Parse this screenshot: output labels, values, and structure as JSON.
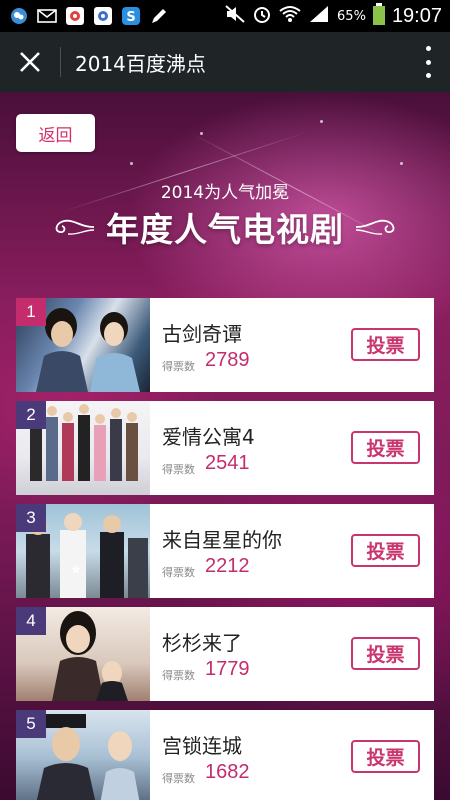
{
  "status_bar": {
    "battery": "65%",
    "time": "19:07"
  },
  "appbar": {
    "title": "2014百度沸点"
  },
  "page": {
    "back_label": "返回",
    "subtitle": "2014为人气加冕",
    "headline": "年度人气电视剧",
    "votes_label": "得票数",
    "vote_button_label": "投票"
  },
  "items": [
    {
      "rank": "1",
      "title": "古剑奇谭",
      "votes": "2789",
      "rank_color": "#c42c6d"
    },
    {
      "rank": "2",
      "title": "爱情公寓4",
      "votes": "2541",
      "rank_color": "#4a3a7a"
    },
    {
      "rank": "3",
      "title": "来自星星的你",
      "votes": "2212",
      "rank_color": "#4a3a7a"
    },
    {
      "rank": "4",
      "title": "杉杉来了",
      "votes": "1779",
      "rank_color": "#4a3a7a"
    },
    {
      "rank": "5",
      "title": "宫锁连城",
      "votes": "1682",
      "rank_color": "#4a3a7a"
    }
  ],
  "colors": {
    "accent": "#c42c6d",
    "appbar_bg": "#1f2426"
  },
  "icons": [
    "wechat-notification-icon",
    "email-icon",
    "app-icon",
    "app-icon",
    "skype-icon",
    "pencil-icon",
    "mute-icon",
    "alarm-icon",
    "wifi-icon",
    "signal-icon",
    "battery-icon"
  ]
}
